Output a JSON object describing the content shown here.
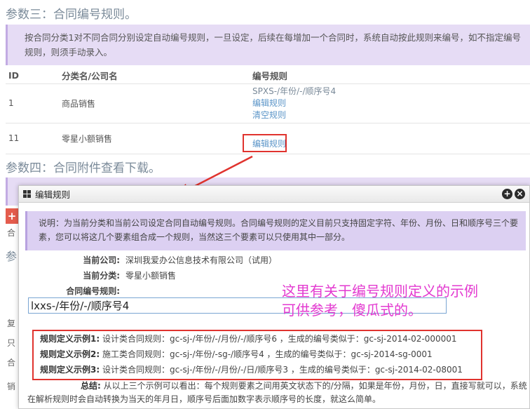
{
  "section3": {
    "title": "参数三：合同编号规则。",
    "info": "按合同分类1对不同合同分别设定自动编号规则，一旦设定，后续在每增加一个合同时，系统自动按此规则来编号，如不指定编号规则，则须手动录入。"
  },
  "table": {
    "headers": [
      "ID",
      "分类名/公司名",
      "编号规则"
    ],
    "rows": [
      {
        "id": "1",
        "name": "商品销售",
        "rule": "SPXS-/年份/-/顺序号4",
        "links": [
          "编辑规则",
          "清空规则"
        ]
      },
      {
        "id": "11",
        "name": "零星小额销售",
        "rule": "",
        "links": [
          "编辑规则"
        ]
      }
    ]
  },
  "section4": {
    "title": "参数四：合同附件查看下载。"
  },
  "left_fragments": [
    "合",
    "参",
    "复",
    "只",
    "合",
    "销"
  ],
  "dialog": {
    "title": "编辑规则",
    "note": "说明：为当前分类和当前公司设定合同自动编号规则。合同编号规则的定义目前只支持固定字符、年份、月份、日和顺序号三个要素，您可以将这几个要素组合成一个规则，当然这三个要素可以只使用其中一部分。",
    "company_label": "当前公司:",
    "company_value": "深圳我爱办公信息技术有限公司（试用）",
    "category_label": "当前分类:",
    "category_value": "零星小额销售",
    "rule_label": "合同编号规则:",
    "rule_value": "lxxs-/年份/-/顺序号4",
    "examples": [
      {
        "label": "规则定义示例1:",
        "text": "设计类合同规则：gc-sj-/年份/-/月份/-/顺序号6 ，生成的编号类似于：gc-sj-2014-02-000001"
      },
      {
        "label": "规则定义示例2:",
        "text": "施工类合同规则：gc-sj-/年份/-sg-/顺序号4 ，生成的编号类似于：gc-sj-2014-sg-0001"
      },
      {
        "label": "规则定义示例3:",
        "text": "设计类合同规则：gc-sj-/年份/-/月份/-/日/顺序号3 ，生成的编号类似于：gc-sj-2014-02-08001"
      }
    ],
    "summary_label": "总结:",
    "summary_text": "从以上三个示例可以看出：每个规则要素之间用英文状态下的/分隔，如果是年份，月份，日，直接写就可以，系统在解析规则时会自动转换为当天的年月日，顺序号后面加数字表示顺序号的长度，就这么简单。"
  },
  "annotation": {
    "line1": "这里有关于编号规则定义的示例",
    "line2": "可供参考，傻瓜式的。",
    "color": "#e33ad0"
  },
  "colors": {
    "highlight": "#e0332e",
    "link": "#5b95c8",
    "info_bg": "#e6dcf5"
  }
}
